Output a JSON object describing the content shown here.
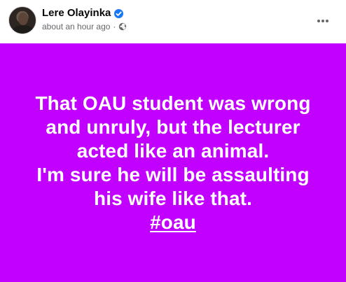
{
  "author": {
    "name": "Lere Olayinka",
    "verified": true,
    "avatar": "avatar-photo"
  },
  "post_meta": {
    "time": "about an hour ago",
    "separator": "·",
    "privacy_icon": "globe-icon"
  },
  "actions": {
    "more_icon": "more-options-icon"
  },
  "post": {
    "background_color": "#c200ff",
    "text_color": "#ffffff",
    "lines": [
      "That OAU student was wrong",
      "and unruly, but the lecturer",
      "acted like an animal.",
      "I'm sure he will be assaulting",
      "his wife like that."
    ],
    "hashtag": "#oau"
  },
  "colors": {
    "verified_badge": "#1877f2",
    "meta_text": "#65676b",
    "name_text": "#050505"
  }
}
